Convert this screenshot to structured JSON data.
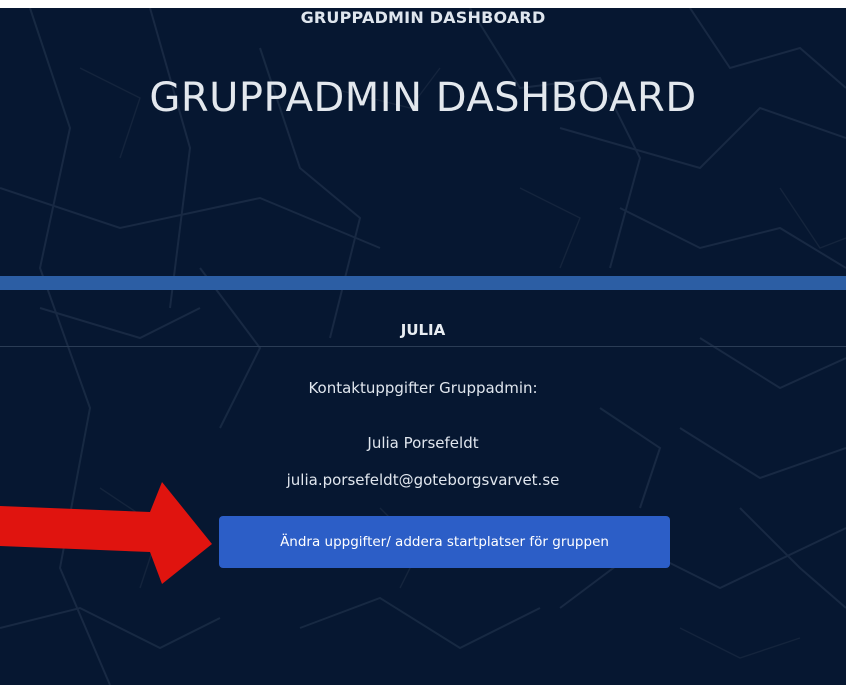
{
  "header": {
    "top_title": "GRUPPADMIN DASHBOARD",
    "hero_title": "GRUPPADMIN DASHBOARD"
  },
  "group": {
    "name": "JULIA"
  },
  "contact": {
    "label": "Kontaktuppgifter Gruppadmin:",
    "name": "Julia Porsefeldt",
    "email": "julia.porsefeldt@goteborgsvarvet.se"
  },
  "actions": {
    "edit_button_label": "Ändra uppgifter/ addera startplatser för gruppen"
  },
  "colors": {
    "background": "#061731",
    "band": "#2c5ea4",
    "button": "#2c5ec7",
    "annotation_arrow": "#e0140f"
  }
}
